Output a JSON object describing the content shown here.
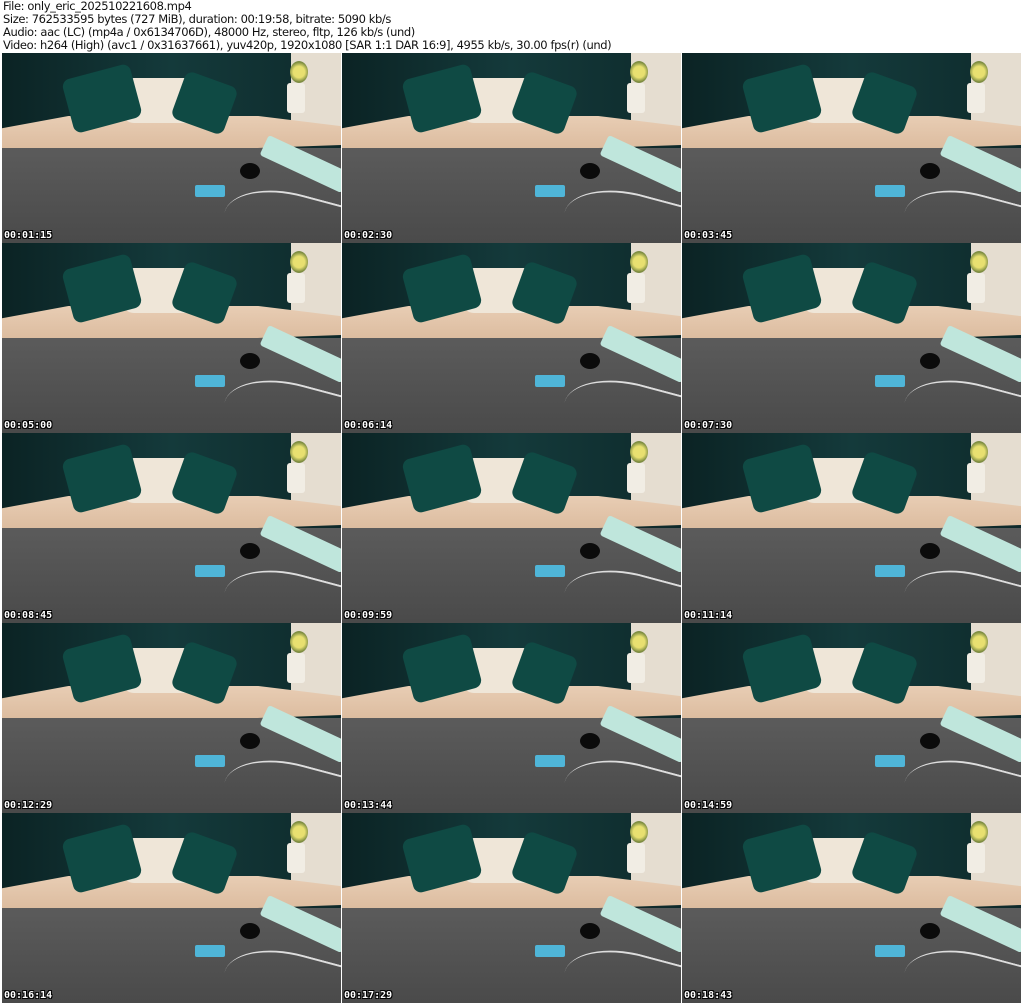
{
  "header": {
    "file": "File: only_eric_202510221608.mp4",
    "size": "Size: 762533595 bytes (727 MiB), duration: 00:19:58, bitrate: 5090 kb/s",
    "audio": "Audio: aac (LC) (mp4a / 0x6134706D), 48000 Hz, stereo, fltp, 126 kb/s (und)",
    "video": "Video: h264 (High) (avc1 / 0x31637661), yuv420p, 1920x1080 [SAR 1:1 DAR 16:9], 4955 kb/s, 30.00 fps(r) (und)"
  },
  "frames": [
    "00:01:15",
    "00:02:30",
    "00:03:45",
    "00:05:00",
    "00:06:14",
    "00:07:30",
    "00:08:45",
    "00:09:59",
    "00:11:14",
    "00:12:29",
    "00:13:44",
    "00:14:59",
    "00:16:14",
    "00:17:29",
    "00:18:43"
  ]
}
